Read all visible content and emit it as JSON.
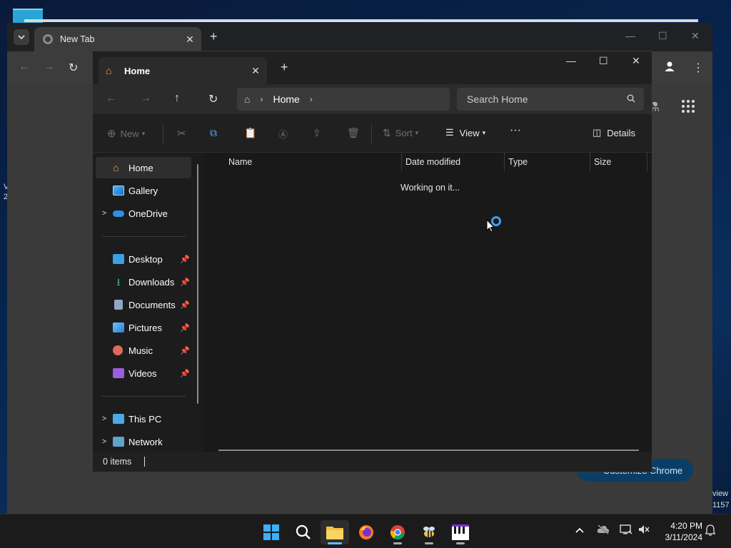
{
  "chrome": {
    "tab_title": "New Tab",
    "customize_label": "Customize Chrome"
  },
  "explorer": {
    "tab_title": "Home",
    "breadcrumb": "Home",
    "search_placeholder": "Search Home",
    "commands": {
      "new": "New",
      "sort": "Sort",
      "view": "View",
      "details": "Details"
    },
    "nav": {
      "quick": [
        "Home",
        "Gallery",
        "OneDrive"
      ],
      "pinned": [
        "Desktop",
        "Downloads",
        "Documents",
        "Pictures",
        "Music",
        "Videos"
      ],
      "bottom": [
        "This PC",
        "Network"
      ]
    },
    "columns": [
      "Name",
      "Date modified",
      "Type",
      "Size"
    ],
    "loading_text": "Working on it...",
    "status": "0 items"
  },
  "desktop_edge": {
    "left_top": "V",
    "left_num": "2",
    "right_a": "view",
    "right_b": "1157"
  },
  "taskbar": {
    "time": "4:20 PM",
    "date": "3/11/2024"
  },
  "colors": {
    "accent": "#3aa0ff",
    "folder": "#f2a84a",
    "chrome_button": "#0b3e66"
  }
}
